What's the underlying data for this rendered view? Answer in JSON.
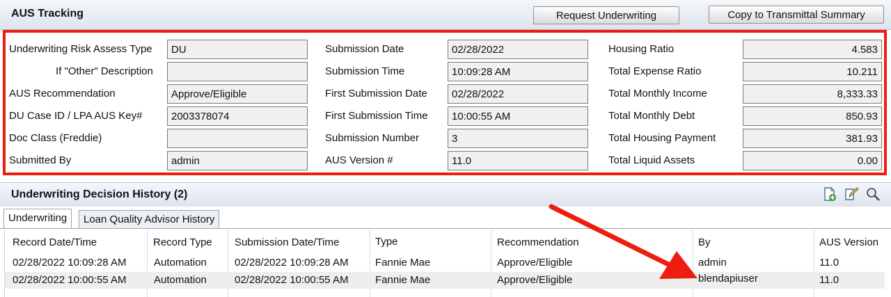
{
  "header": {
    "title": "AUS Tracking",
    "request_btn": "Request Underwriting",
    "copy_btn": "Copy to Transmittal Summary"
  },
  "form": {
    "col1": [
      {
        "label": "Underwriting Risk Assess Type",
        "value": "DU"
      },
      {
        "label": "If \"Other\" Description",
        "value": ""
      },
      {
        "label": "AUS Recommendation",
        "value": "Approve/Eligible"
      },
      {
        "label": "DU Case ID / LPA AUS Key#",
        "value": "2003378074"
      },
      {
        "label": "Doc Class (Freddie)",
        "value": ""
      },
      {
        "label": "Submitted By",
        "value": "admin"
      }
    ],
    "col2": [
      {
        "label": "Submission Date",
        "value": "02/28/2022"
      },
      {
        "label": "Submission Time",
        "value": "10:09:28 AM"
      },
      {
        "label": "First Submission Date",
        "value": "02/28/2022"
      },
      {
        "label": "First Submission Time",
        "value": "10:00:55 AM"
      },
      {
        "label": "Submission Number",
        "value": "3"
      },
      {
        "label": "AUS Version #",
        "value": "11.0"
      }
    ],
    "col3": [
      {
        "label": "Housing Ratio",
        "value": "4.583"
      },
      {
        "label": "Total Expense Ratio",
        "value": "10.211"
      },
      {
        "label": "Total Monthly Income",
        "value": "8,333.33"
      },
      {
        "label": "Total Monthly Debt",
        "value": "850.93"
      },
      {
        "label": "Total Housing Payment",
        "value": "381.93"
      },
      {
        "label": "Total Liquid Assets",
        "value": "0.00"
      }
    ]
  },
  "history": {
    "title": "Underwriting Decision History (2)",
    "tools": [
      "add-document-icon",
      "edit-icon",
      "search-icon"
    ],
    "tabs": [
      "Underwriting",
      "Loan Quality Advisor History"
    ],
    "columns": [
      "Record Date/Time",
      "Record Type",
      "Submission Date/Time",
      "Type",
      "Recommendation",
      "By",
      "AUS Version"
    ],
    "rows": [
      [
        "02/28/2022 10:09:28 AM",
        "Automation",
        "02/28/2022 10:09:28 AM",
        "Fannie Mae",
        "Approve/Eligible",
        "admin",
        "11.0"
      ],
      [
        "02/28/2022 10:00:55 AM",
        "Automation",
        "02/28/2022 10:00:55 AM",
        "Fannie Mae",
        "Approve/Eligible",
        "blendapiuser",
        "11.0"
      ]
    ]
  },
  "colors": {
    "highlight_red": "#ef1c10",
    "arrow_red": "#ef1c10"
  }
}
